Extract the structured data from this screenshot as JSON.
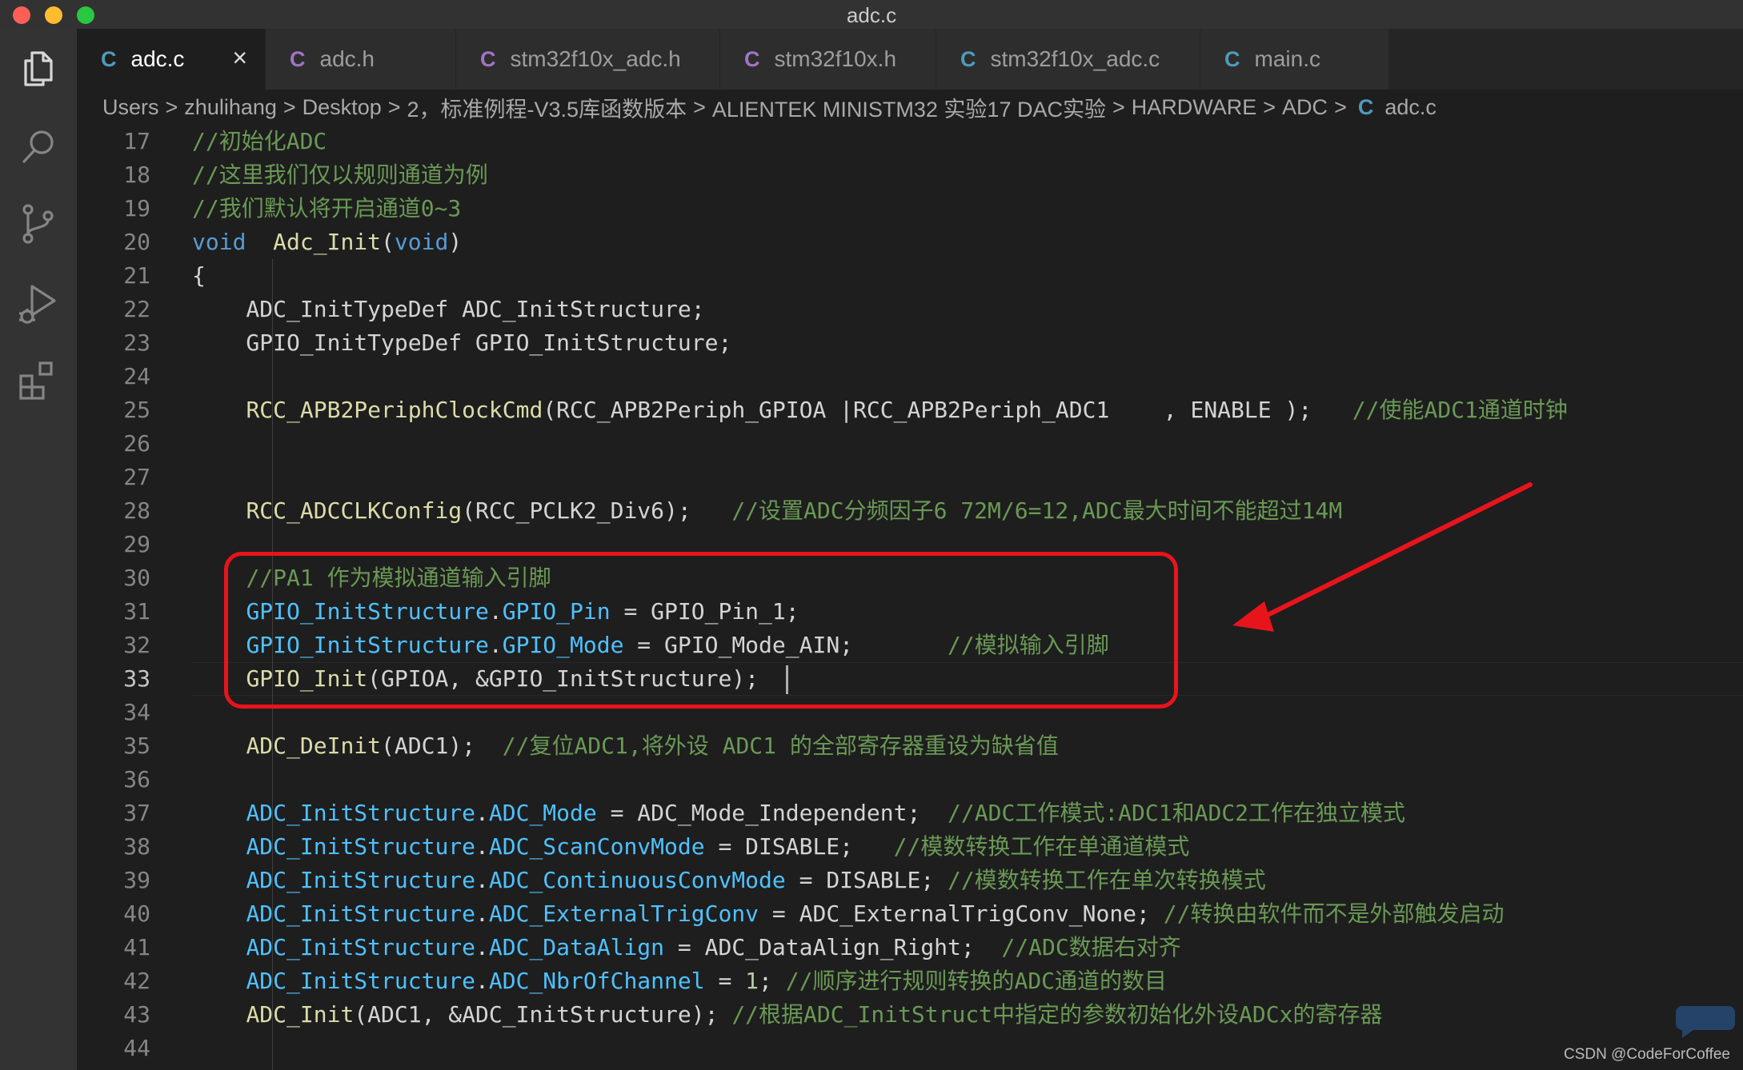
{
  "window": {
    "title": "adc.c"
  },
  "tabs": [
    {
      "icon": "C",
      "label": "adc.c",
      "active": true,
      "close": "×"
    },
    {
      "icon": "C",
      "label": "adc.h"
    },
    {
      "icon": "C",
      "label": "stm32f10x_adc.h"
    },
    {
      "icon": "C",
      "label": "stm32f10x.h"
    },
    {
      "icon": "C",
      "label": "stm32f10x_adc.c"
    },
    {
      "icon": "C",
      "label": "main.c"
    }
  ],
  "breadcrumb": {
    "items": [
      "Users",
      "zhulihang",
      "Desktop",
      "2，标准例程-V3.5库函数版本",
      "ALIENTEK MINISTM32 实验17 DAC实验",
      "HARDWARE",
      "ADC"
    ],
    "separator": ">",
    "file_icon": "C",
    "file": "adc.c"
  },
  "activity_icons": [
    "explorer-icon",
    "search-icon",
    "source-control-icon",
    "run-debug-icon",
    "extensions-icon"
  ],
  "editor": {
    "current_line": "33",
    "lines": [
      {
        "n": "17",
        "tokens": [
          [
            "t-cm",
            "//初始化ADC"
          ]
        ]
      },
      {
        "n": "18",
        "tokens": [
          [
            "t-cm",
            "//这里我们仅以规则通道为例"
          ]
        ]
      },
      {
        "n": "19",
        "tokens": [
          [
            "t-cm",
            "//我们默认将开启通道0~3"
          ]
        ]
      },
      {
        "n": "20",
        "tokens": [
          [
            "t-kw",
            "void"
          ],
          [
            "t-plain",
            "  "
          ],
          [
            "t-fn",
            "Adc_Init"
          ],
          [
            "t-plain",
            "("
          ],
          [
            "t-kw",
            "void"
          ],
          [
            "t-plain",
            ")"
          ]
        ]
      },
      {
        "n": "21",
        "tokens": [
          [
            "t-plain",
            "{"
          ]
        ]
      },
      {
        "n": "22",
        "tokens": [
          [
            "t-plain",
            "    ADC_InitTypeDef ADC_InitStructure;"
          ]
        ]
      },
      {
        "n": "23",
        "tokens": [
          [
            "t-plain",
            "    GPIO_InitTypeDef GPIO_InitStructure;"
          ]
        ]
      },
      {
        "n": "24",
        "tokens": []
      },
      {
        "n": "25",
        "tokens": [
          [
            "t-plain",
            "    "
          ],
          [
            "t-fn",
            "RCC_APB2PeriphClockCmd"
          ],
          [
            "t-plain",
            "(RCC_APB2Periph_GPIOA |RCC_APB2Periph_ADC1    , ENABLE );   "
          ],
          [
            "t-cm",
            "//使能ADC1通道时钟"
          ]
        ]
      },
      {
        "n": "26",
        "tokens": []
      },
      {
        "n": "27",
        "tokens": []
      },
      {
        "n": "28",
        "tokens": [
          [
            "t-plain",
            "    "
          ],
          [
            "t-fn",
            "RCC_ADCCLKConfig"
          ],
          [
            "t-plain",
            "(RCC_PCLK2_Div6);   "
          ],
          [
            "t-cm",
            "//设置ADC分频因子6 72M/6=12,ADC最大时间不能超过14M"
          ]
        ]
      },
      {
        "n": "29",
        "tokens": []
      },
      {
        "n": "30",
        "tokens": [
          [
            "t-plain",
            "    "
          ],
          [
            "t-cm",
            "//PA1 作为模拟通道输入引脚"
          ]
        ]
      },
      {
        "n": "31",
        "tokens": [
          [
            "t-plain",
            "    "
          ],
          [
            "t-var",
            "GPIO_InitStructure"
          ],
          [
            "t-plain",
            "."
          ],
          [
            "t-var",
            "GPIO_Pin"
          ],
          [
            "t-plain",
            " = GPIO_Pin_1;"
          ]
        ]
      },
      {
        "n": "32",
        "tokens": [
          [
            "t-plain",
            "    "
          ],
          [
            "t-var",
            "GPIO_InitStructure"
          ],
          [
            "t-plain",
            "."
          ],
          [
            "t-var",
            "GPIO_Mode"
          ],
          [
            "t-plain",
            " = GPIO_Mode_AIN;       "
          ],
          [
            "t-cm",
            "//模拟输入引脚"
          ]
        ]
      },
      {
        "n": "33",
        "tokens": [
          [
            "t-plain",
            "    "
          ],
          [
            "t-fn",
            "GPIO_Init"
          ],
          [
            "t-plain",
            "(GPIOA, &GPIO_InitStructure);  "
          ]
        ]
      },
      {
        "n": "34",
        "tokens": []
      },
      {
        "n": "35",
        "tokens": [
          [
            "t-plain",
            "    "
          ],
          [
            "t-fn",
            "ADC_DeInit"
          ],
          [
            "t-plain",
            "(ADC1);  "
          ],
          [
            "t-cm",
            "//复位ADC1,将外设 ADC1 的全部寄存器重设为缺省值"
          ]
        ]
      },
      {
        "n": "36",
        "tokens": []
      },
      {
        "n": "37",
        "tokens": [
          [
            "t-plain",
            "    "
          ],
          [
            "t-var",
            "ADC_InitStructure"
          ],
          [
            "t-plain",
            "."
          ],
          [
            "t-var",
            "ADC_Mode"
          ],
          [
            "t-plain",
            " = ADC_Mode_Independent;  "
          ],
          [
            "t-cm",
            "//ADC工作模式:ADC1和ADC2工作在独立模式"
          ]
        ]
      },
      {
        "n": "38",
        "tokens": [
          [
            "t-plain",
            "    "
          ],
          [
            "t-var",
            "ADC_InitStructure"
          ],
          [
            "t-plain",
            "."
          ],
          [
            "t-var",
            "ADC_ScanConvMode"
          ],
          [
            "t-plain",
            " = DISABLE;   "
          ],
          [
            "t-cm",
            "//模数转换工作在单通道模式"
          ]
        ]
      },
      {
        "n": "39",
        "tokens": [
          [
            "t-plain",
            "    "
          ],
          [
            "t-var",
            "ADC_InitStructure"
          ],
          [
            "t-plain",
            "."
          ],
          [
            "t-var",
            "ADC_ContinuousConvMode"
          ],
          [
            "t-plain",
            " = DISABLE; "
          ],
          [
            "t-cm",
            "//模数转换工作在单次转换模式"
          ]
        ]
      },
      {
        "n": "40",
        "tokens": [
          [
            "t-plain",
            "    "
          ],
          [
            "t-var",
            "ADC_InitStructure"
          ],
          [
            "t-plain",
            "."
          ],
          [
            "t-var",
            "ADC_ExternalTrigConv"
          ],
          [
            "t-plain",
            " = ADC_ExternalTrigConv_None; "
          ],
          [
            "t-cm",
            "//转换由软件而不是外部触发启动"
          ]
        ]
      },
      {
        "n": "41",
        "tokens": [
          [
            "t-plain",
            "    "
          ],
          [
            "t-var",
            "ADC_InitStructure"
          ],
          [
            "t-plain",
            "."
          ],
          [
            "t-var",
            "ADC_DataAlign"
          ],
          [
            "t-plain",
            " = ADC_DataAlign_Right;  "
          ],
          [
            "t-cm",
            "//ADC数据右对齐"
          ]
        ]
      },
      {
        "n": "42",
        "tokens": [
          [
            "t-plain",
            "    "
          ],
          [
            "t-var",
            "ADC_InitStructure"
          ],
          [
            "t-plain",
            "."
          ],
          [
            "t-var",
            "ADC_NbrOfChannel"
          ],
          [
            "t-plain",
            " = "
          ],
          [
            "t-num",
            "1"
          ],
          [
            "t-plain",
            "; "
          ],
          [
            "t-cm",
            "//顺序进行规则转换的ADC通道的数目"
          ]
        ]
      },
      {
        "n": "43",
        "tokens": [
          [
            "t-plain",
            "    "
          ],
          [
            "t-fn",
            "ADC_Init"
          ],
          [
            "t-plain",
            "(ADC1, &ADC_InitStructure); "
          ],
          [
            "t-cm",
            "//根据ADC_InitStruct中指定的参数初始化外设ADCx的寄存器"
          ]
        ]
      },
      {
        "n": "44",
        "tokens": []
      }
    ]
  },
  "annotation": {
    "color": "#e8141c"
  },
  "watermark": "CSDN @CodeForCoffee",
  "colors": {
    "keyword": "#569cd6",
    "function": "#dcdcaa",
    "variable": "#4fc1ff",
    "comment": "#6a9955",
    "number": "#b5cea8"
  }
}
